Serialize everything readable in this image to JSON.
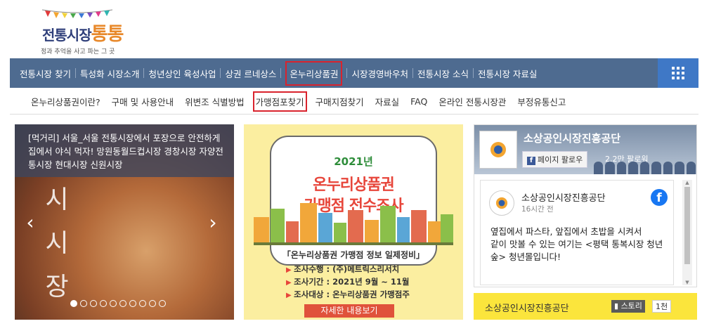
{
  "logo": {
    "title_main": "전통시장",
    "title_accent": "통통",
    "tagline": "정과 추억을 사고 파는 그 곳"
  },
  "main_nav": {
    "items": [
      {
        "label": "전통시장 찾기"
      },
      {
        "label": "특성화 시장소개"
      },
      {
        "label": "청년상인 육성사업"
      },
      {
        "label": "상권 르네상스"
      },
      {
        "label": "온누리상품권",
        "active": true
      },
      {
        "label": "시장경영바우처"
      },
      {
        "label": "전통시장 소식"
      },
      {
        "label": "전통시장 자료실"
      }
    ],
    "menu_icon": "grid-menu-icon"
  },
  "sub_nav": {
    "items": [
      {
        "label": "온누리상품권이란?"
      },
      {
        "label": "구매 및 사용안내"
      },
      {
        "label": "위변조 식별방법"
      },
      {
        "label": "가맹점포찾기",
        "active": true
      },
      {
        "label": "구매지점찾기"
      },
      {
        "label": "자료실"
      },
      {
        "label": "FAQ"
      },
      {
        "label": "온라인 전통시장관"
      },
      {
        "label": "부정유통신고"
      }
    ]
  },
  "slider": {
    "caption": "[먹거리] 서울_서울 전통시장에서 포장으로 안전하게 집에서 야식 먹자! 망원동월드컵시장 경창시장 자양전통시장 현대시장 신원시장",
    "overlay_chars": [
      "시",
      "시",
      "장"
    ],
    "prev_icon": "chevron-left-icon",
    "next_icon": "chevron-right-icon",
    "page_count": 10,
    "current_page": 1
  },
  "banner": {
    "year": "2021년",
    "title_line1": "온누리상품권",
    "title_line2": "가맹점 전수조사",
    "info_title": "「온누리상품권 가맹점 정보 일제정비」",
    "info_items": [
      "조사수행 : (주)메트릭스리서치",
      "조사기간 : 2021년 9월 ~ 11월",
      "조사대상 : 온누리상품권 가맹점주"
    ],
    "button_label": "자세한 내용보기"
  },
  "facebook": {
    "page_name": "소상공인시장진흥공단",
    "follow_label": "페이지 팔로우",
    "followers": "2.2만 팔로워",
    "post": {
      "author": "소상공인시장진흥공단",
      "time": "16시간 전",
      "text": "옆집에서 파스타, 앞집에서 초밥을 시켜서\n같이 맛볼 수 있는 여기는 <평택 통복시장 청년숲> 청년몰입니다!"
    },
    "brand_color": "#1877f2"
  },
  "story": {
    "name": "소상공인시장진흥공단",
    "button_label": "스토리",
    "count": "1천"
  }
}
